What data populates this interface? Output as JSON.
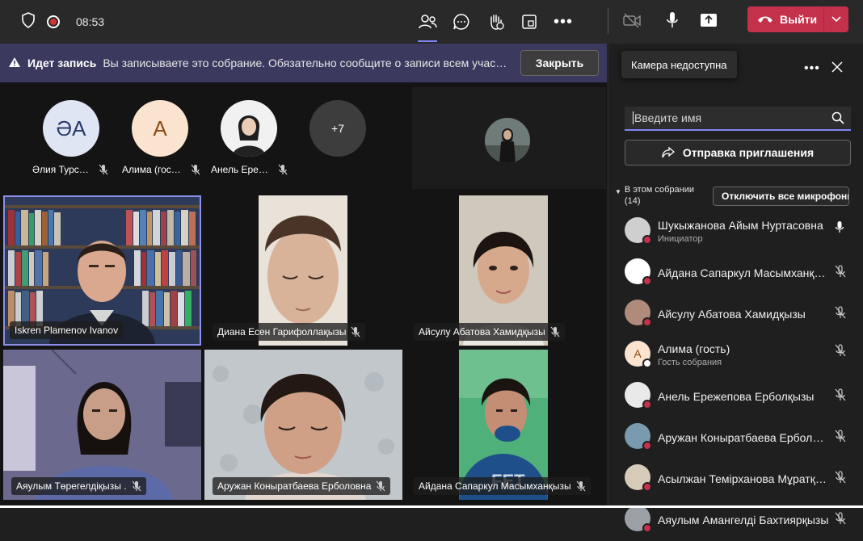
{
  "header": {
    "time": "08:53",
    "leave_label": "Выйти"
  },
  "banner": {
    "title": "Идет запись",
    "message": "Вы записываете это собрание. Обязательно сообщите о записи всем участникам.",
    "close_label": "Закрыть"
  },
  "avatars": [
    {
      "initials": "ӘА",
      "name": "Әлия Турс…",
      "bg": "#dfe5f2",
      "fg": "#2b3a6b"
    },
    {
      "initials": "А",
      "name": "Алима (гос…",
      "bg": "#fbe4cf",
      "fg": "#8f4a14"
    },
    {
      "initials": "",
      "name": "Анель Ере…",
      "bg": "#e9e9e9",
      "fg": "#222"
    },
    {
      "initials": "+7",
      "name": "",
      "bg": "#3d3d3d",
      "fg": "#ffffff"
    }
  ],
  "tiles": [
    {
      "name": "Iskren Plamenov Ivanov",
      "muted": false
    },
    {
      "name": "Диана Есен Гарифоллақызы",
      "muted": true
    },
    {
      "name": "Айсулу Абатова Хамидқызы",
      "muted": true
    },
    {
      "name": "Аяулым Төрегелдіқызы .",
      "muted": true
    },
    {
      "name": "Аружан Коныратбаева Ерболовна",
      "muted": true
    },
    {
      "name": "Айдана Сапаркул Масымханқызы",
      "muted": true
    }
  ],
  "panel": {
    "tooltip": "Камера недоступна",
    "search_placeholder": "Введите имя",
    "invite_label": "Отправка приглашения",
    "section_label": "В этом собрании",
    "section_count": "(14)",
    "mute_all_label": "Отключить все микрофоны",
    "participants": [
      {
        "name": "Шукыжанова Айым Нуртасовна",
        "sub": "Инициатор",
        "initials": "",
        "avatar_bg": "#cfcfcf",
        "status": "#c4314b",
        "mic": "on"
      },
      {
        "name": "Айдана Сапаркул Масымханқызы",
        "sub": "",
        "initials": "",
        "avatar_bg": "#ffffff",
        "status": "#c4314b",
        "mic": "off"
      },
      {
        "name": "Айсулу Абатова Хамидқызы",
        "sub": "",
        "initials": "",
        "avatar_bg": "#b08a7a",
        "status": "#c4314b",
        "mic": "off"
      },
      {
        "name": "Алима (гость)",
        "sub": "Гость собрания",
        "initials": "A",
        "avatar_bg": "#fbe4cf",
        "status": "#ffffff",
        "mic": "off"
      },
      {
        "name": "Анель Ережепова Ерболқызы",
        "sub": "",
        "initials": "",
        "avatar_bg": "#e9e9e9",
        "status": "#c4314b",
        "mic": "off"
      },
      {
        "name": "Аружан Коныратбаева Ерболовна",
        "sub": "",
        "initials": "",
        "avatar_bg": "#7a9ab0",
        "status": "#c4314b",
        "mic": "off"
      },
      {
        "name": "Асылжан Темірханова Мұратқызы",
        "sub": "",
        "initials": "",
        "avatar_bg": "#d6cbb8",
        "status": "#c4314b",
        "mic": "off"
      },
      {
        "name": "Аяулым Амангелді Бахтиярқызы",
        "sub": "",
        "initials": "",
        "avatar_bg": "#9aa0a6",
        "status": "#c4314b",
        "mic": "off"
      }
    ]
  }
}
